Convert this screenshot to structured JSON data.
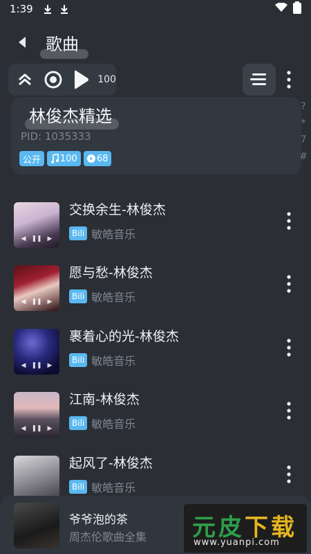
{
  "status_bar": {
    "time": "1:39"
  },
  "header": {
    "title": "歌曲"
  },
  "toolbar": {
    "play_count": "100"
  },
  "playlist": {
    "name": "林俊杰精选",
    "pid": "PID: 1035333",
    "tags": {
      "visibility": "公开",
      "song_count": "100",
      "play_count": "68"
    }
  },
  "index_bar": [
    "?",
    "*",
    "7",
    "#"
  ],
  "songs": [
    {
      "title": "交换余生-林俊杰",
      "source": "Bili",
      "artist": "敏皓音乐"
    },
    {
      "title": "愿与愁-林俊杰",
      "source": "Bili",
      "artist": "敏皓音乐"
    },
    {
      "title": "裹着心的光-林俊杰",
      "source": "Bili",
      "artist": "敏皓音乐"
    },
    {
      "title": "江南-林俊杰",
      "source": "Bili",
      "artist": "敏皓音乐"
    },
    {
      "title": "起风了-林俊杰",
      "source": "Bili",
      "artist": "敏皓音乐"
    }
  ],
  "now_playing": {
    "title": "爷爷泡的茶",
    "subtitle": "周杰伦歌曲全集"
  },
  "watermark": {
    "brand_a": "元皮",
    "brand_b": "下载",
    "url": "www.yuanpi.com"
  },
  "colors": {
    "background": "#2b2f35",
    "accent": "#5ab8f0",
    "card": "#323840"
  }
}
